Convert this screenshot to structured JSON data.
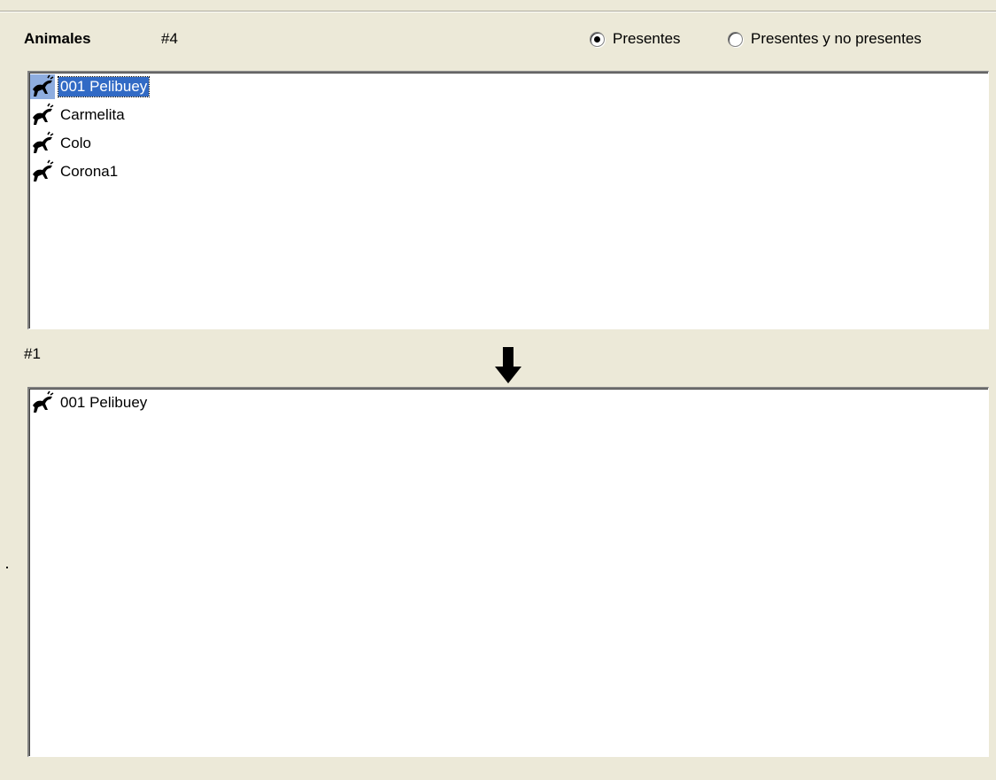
{
  "header": {
    "title": "Animales",
    "count": "#4"
  },
  "filter": {
    "options": [
      {
        "label": "Presentes",
        "selected": true
      },
      {
        "label": "Presentes y no presentes",
        "selected": false
      }
    ]
  },
  "available_list": {
    "items": [
      {
        "label": "001 Pelibuey",
        "icon": "animal-icon",
        "selected": true
      },
      {
        "label": "Carmelita",
        "icon": "animal-icon",
        "selected": false
      },
      {
        "label": "Colo",
        "icon": "animal-icon",
        "selected": false
      },
      {
        "label": "Corona1",
        "icon": "animal-icon",
        "selected": false
      }
    ]
  },
  "transfer": {
    "icon": "arrow-down-icon"
  },
  "selected_list": {
    "count": "#1",
    "items": [
      {
        "label": "001 Pelibuey",
        "icon": "animal-icon",
        "selected": false
      }
    ]
  }
}
